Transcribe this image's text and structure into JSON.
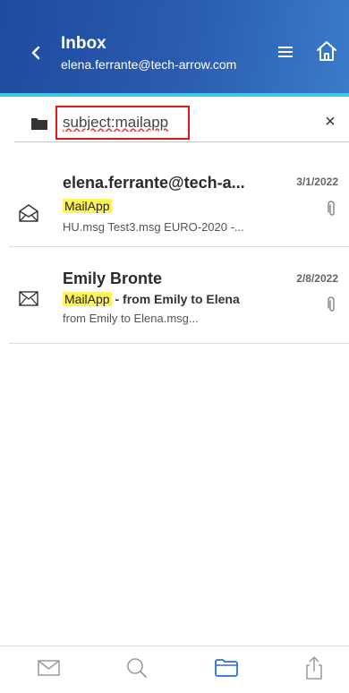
{
  "header": {
    "title": "Inbox",
    "subtitle": "elena.ferrante@tech-arrow.com",
    "accent_color": "#39c8e8",
    "background_color": "#2a5db0",
    "icons": [
      "chevron-left-icon",
      "hamburger-menu-icon",
      "home-icon"
    ]
  },
  "search": {
    "value": "subject:mailapp",
    "clear_label": "×",
    "highlight_color": "#e01818",
    "icons": [
      "folder-icon"
    ]
  },
  "messages": [
    {
      "sender": "elena.ferrante@tech-a...",
      "date": "3/1/2022",
      "subject_highlight": "MailApp",
      "subject_rest": "",
      "preview": "HU.msg Test3.msg EURO-2020 -...",
      "icon": "envelope-open-icon",
      "has_attachment": true
    },
    {
      "sender": "Emily Bronte",
      "date": "2/8/2022",
      "subject_highlight": "MailApp",
      "subject_rest": " - from Emily to Elena",
      "preview": "from Emily to Elena.msg...",
      "icon": "envelope-closed-icon",
      "has_attachment": true
    }
  ],
  "bottom_nav": {
    "tabs": [
      {
        "icon": "mail-icon",
        "active": false
      },
      {
        "icon": "search-icon",
        "active": false
      },
      {
        "icon": "folder-icon",
        "active": true
      },
      {
        "icon": "share-icon",
        "active": false
      }
    ],
    "active_color": "#2a6fd6",
    "inactive_color": "#9a9a9a"
  }
}
